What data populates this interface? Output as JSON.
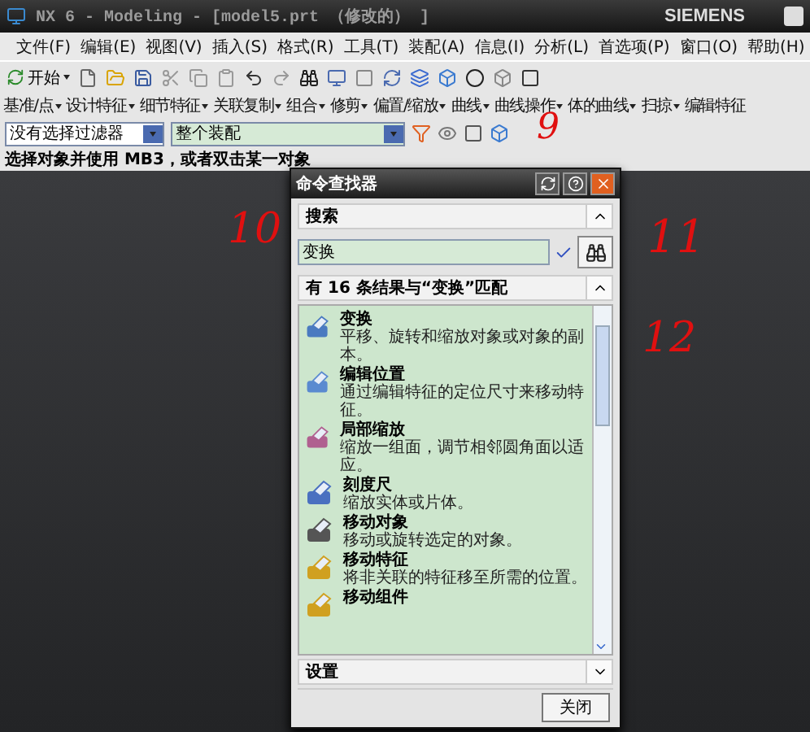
{
  "window": {
    "title": "NX 6 - Modeling - [model5.prt （修改的） ]",
    "brand": "SIEMENS"
  },
  "menu": [
    "文件(F)",
    "编辑(E)",
    "视图(V)",
    "插入(S)",
    "格式(R)",
    "工具(T)",
    "装配(A)",
    "信息(I)",
    "分析(L)",
    "首选项(P)",
    "窗口(O)",
    "帮助(H)"
  ],
  "toolbar": {
    "start": "开始"
  },
  "feature_toolbar": [
    "基准/点",
    "设计特征",
    "细节特征",
    "关联复制",
    "组合",
    "修剪",
    "偏置/缩放",
    "曲线",
    "曲线操作",
    "体的曲线",
    "扫掠",
    "编辑特征"
  ],
  "filters": [
    {
      "value": "没有选择过滤器"
    },
    {
      "value": "整个装配"
    }
  ],
  "status": "选择对象并使用 MB3，或者双击某一对象",
  "dialog": {
    "title": "命令查找器",
    "search_section": {
      "title": "搜索",
      "expanded": true
    },
    "search": {
      "value": "变换"
    },
    "results_section": {
      "title": "有 16 条结果与“变换”匹配",
      "expanded": true
    },
    "results": [
      {
        "name": "变换",
        "description": "平移、旋转和缩放对象或对象的副本。"
      },
      {
        "name": "编辑位置",
        "description": "通过编辑特征的定位尺寸来移动特征。"
      },
      {
        "name": "局部缩放",
        "description": "缩放一组面，调节相邻圆角面以适应。"
      },
      {
        "name": "刻度尺",
        "description": "缩放实体或片体。"
      },
      {
        "name": "移动对象",
        "description": "移动或旋转选定的对象。"
      },
      {
        "name": "移动特征",
        "description": "将非关联的特征移至所需的位置。"
      },
      {
        "name": "移动组件"
      }
    ],
    "settings_section": {
      "title": "设置",
      "expanded": false
    },
    "close_button": "关闭"
  },
  "annotations": [
    {
      "label": "9"
    },
    {
      "label": "10"
    },
    {
      "label": "11"
    },
    {
      "label": "12"
    }
  ]
}
